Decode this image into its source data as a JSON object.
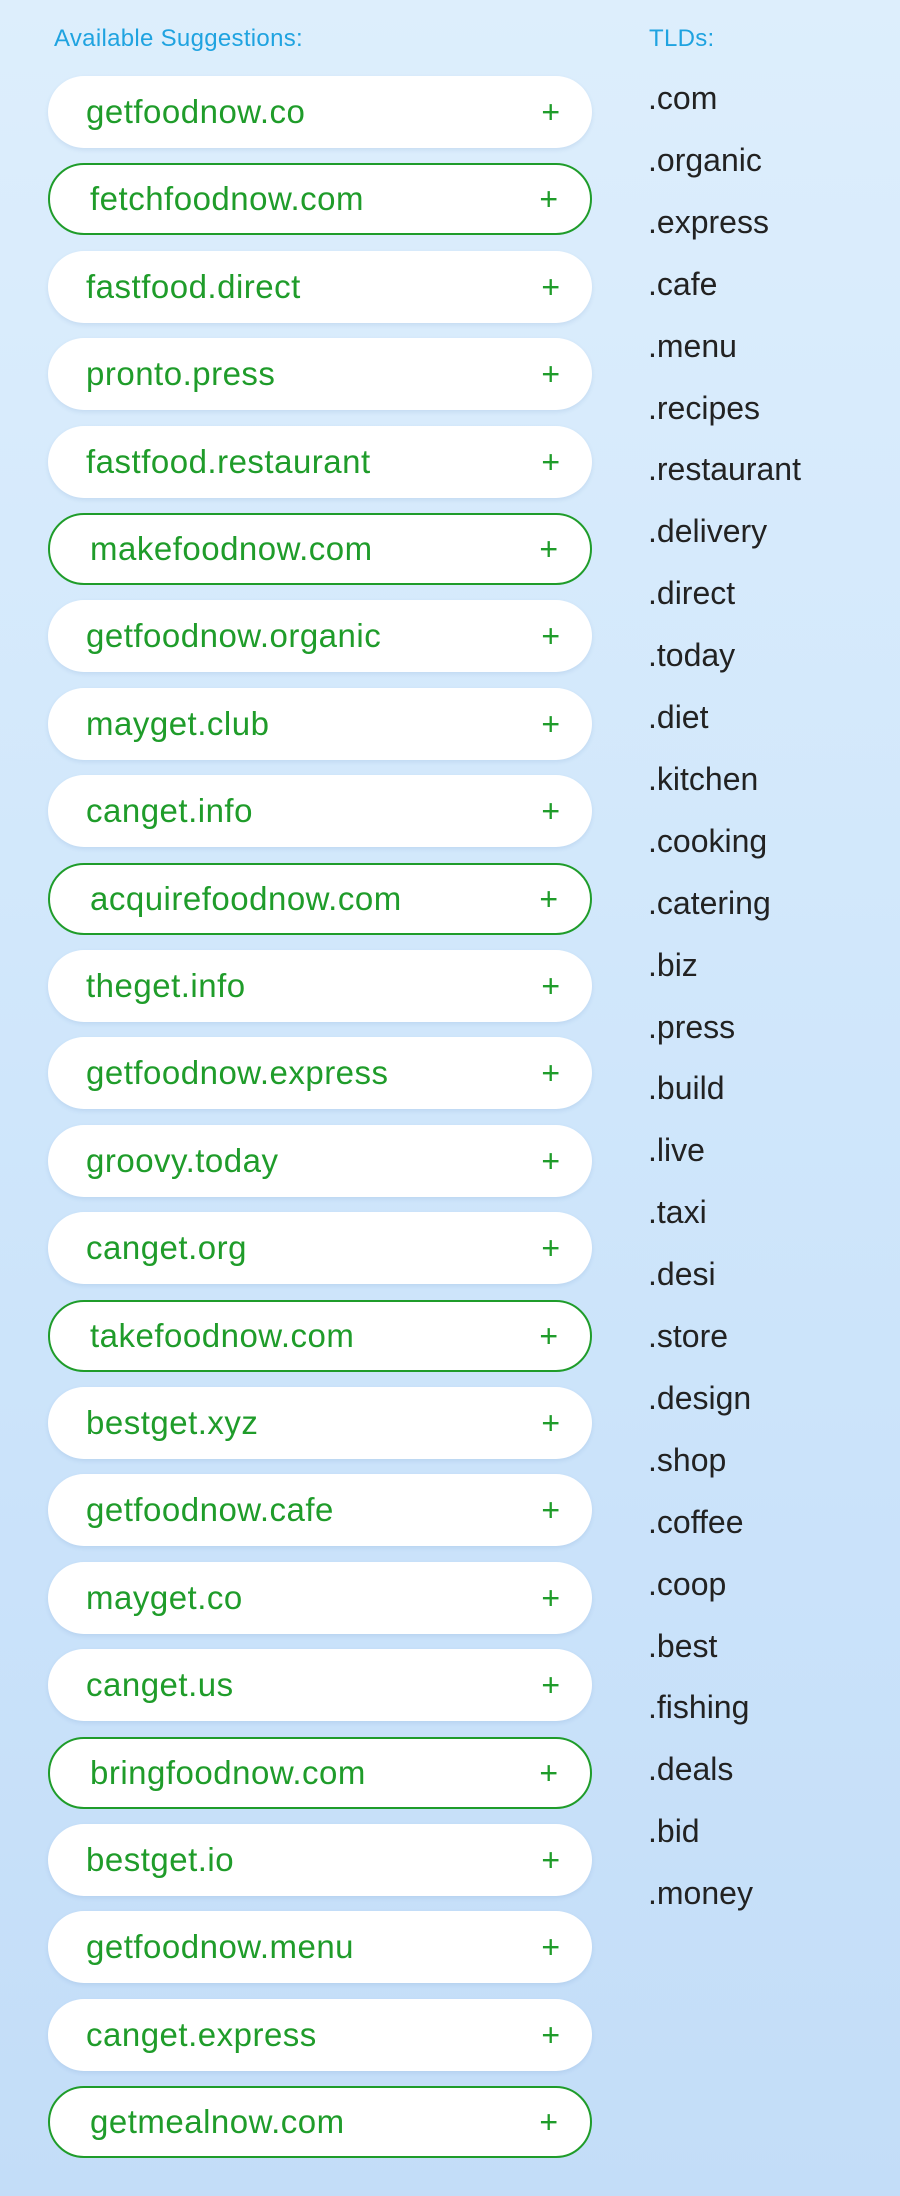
{
  "suggestions_header": "Available Suggestions:",
  "tlds_header": "TLDs:",
  "add_symbol": "+",
  "suggestions": [
    {
      "label": "getfoodnow.co",
      "style": "filled"
    },
    {
      "label": "fetchfoodnow.com",
      "style": "outlined"
    },
    {
      "label": "fastfood.direct",
      "style": "filled"
    },
    {
      "label": "pronto.press",
      "style": "filled"
    },
    {
      "label": "fastfood.restaurant",
      "style": "filled"
    },
    {
      "label": "makefoodnow.com",
      "style": "outlined"
    },
    {
      "label": "getfoodnow.organic",
      "style": "filled"
    },
    {
      "label": "mayget.club",
      "style": "filled"
    },
    {
      "label": "canget.info",
      "style": "filled"
    },
    {
      "label": "acquirefoodnow.com",
      "style": "outlined"
    },
    {
      "label": "theget.info",
      "style": "filled"
    },
    {
      "label": "getfoodnow.express",
      "style": "filled"
    },
    {
      "label": "groovy.today",
      "style": "filled"
    },
    {
      "label": "canget.org",
      "style": "filled"
    },
    {
      "label": "takefoodnow.com",
      "style": "outlined"
    },
    {
      "label": "bestget.xyz",
      "style": "filled"
    },
    {
      "label": "getfoodnow.cafe",
      "style": "filled"
    },
    {
      "label": "mayget.co",
      "style": "filled"
    },
    {
      "label": "canget.us",
      "style": "filled"
    },
    {
      "label": "bringfoodnow.com",
      "style": "outlined"
    },
    {
      "label": "bestget.io",
      "style": "filled"
    },
    {
      "label": "getfoodnow.menu",
      "style": "filled"
    },
    {
      "label": "canget.express",
      "style": "filled"
    },
    {
      "label": "getmealnow.com",
      "style": "outlined"
    }
  ],
  "tlds": [
    ".com",
    ".organic",
    ".express",
    ".cafe",
    ".menu",
    ".recipes",
    ".restaurant",
    ".delivery",
    ".direct",
    ".today",
    ".diet",
    ".kitchen",
    ".cooking",
    ".catering",
    ".biz",
    ".press",
    ".build",
    ".live",
    ".taxi",
    ".desi",
    ".store",
    ".design",
    ".shop",
    ".coffee",
    ".coop",
    ".best",
    ".fishing",
    ".deals",
    ".bid",
    ".money"
  ],
  "colors": {
    "accent_green": "#1f9c2a",
    "header_blue": "#1fa3e0",
    "text_dark": "#222222"
  }
}
